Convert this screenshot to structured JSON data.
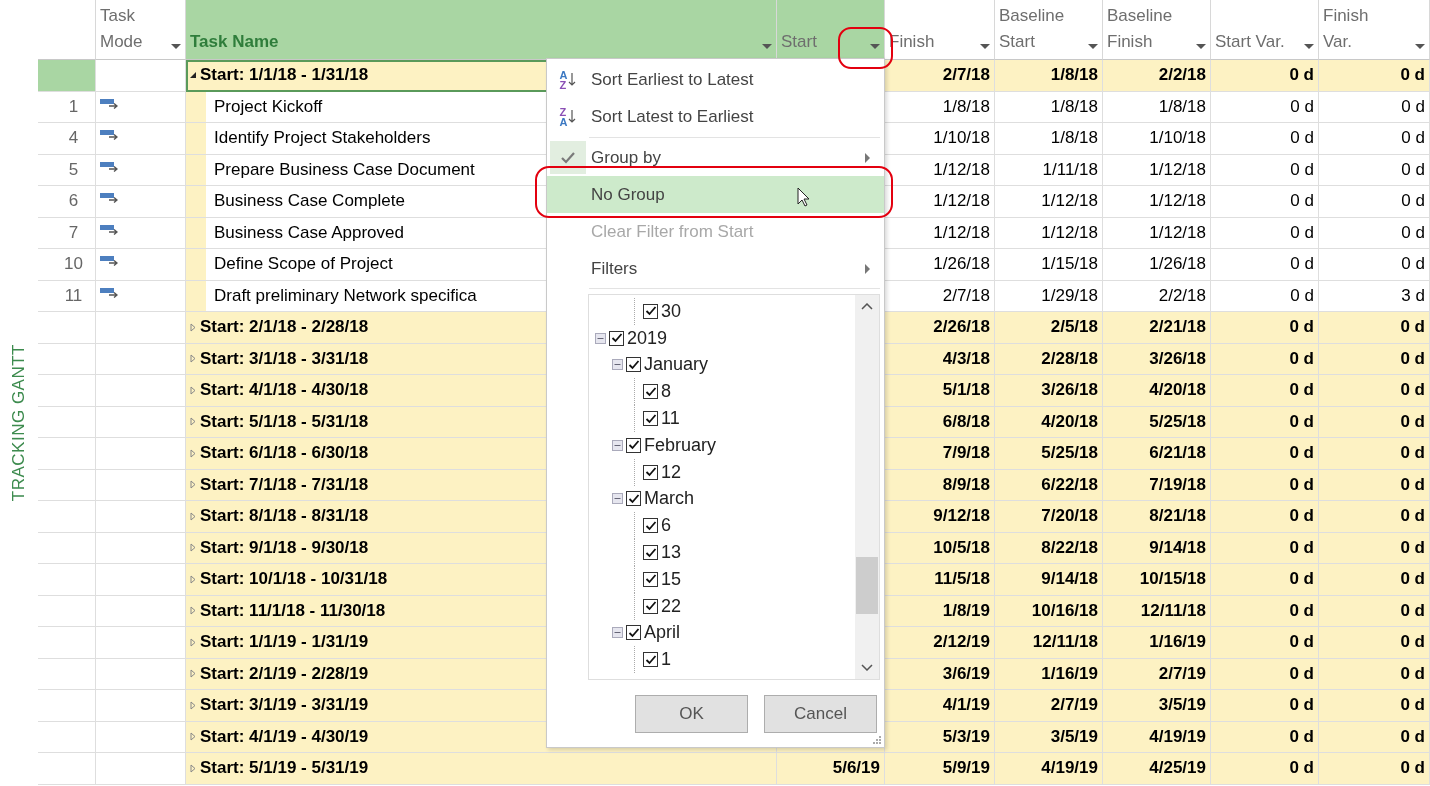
{
  "side_label": "TRACKING GANTT",
  "table": {
    "columns": [
      {
        "label": "Task\nMode",
        "selected": false,
        "hovered": false
      },
      {
        "label": "Task Name",
        "selected": true,
        "hovered": false
      },
      {
        "label": "Start",
        "selected": false,
        "hovered": true
      },
      {
        "label": "Finish",
        "selected": false,
        "hovered": false
      },
      {
        "label": "Baseline\nStart",
        "selected": false,
        "hovered": false
      },
      {
        "label": "Baseline\nFinish",
        "selected": false,
        "hovered": false
      },
      {
        "label": "Start Var.",
        "selected": false,
        "hovered": false
      },
      {
        "label": "Finish\nVar.",
        "selected": false,
        "hovered": false
      }
    ],
    "rows": [
      {
        "kind": "group",
        "expanded": true,
        "selected": true,
        "name": "Start: 1/1/18 - 1/31/18",
        "finish": "2/7/18",
        "baseline_start": "1/8/18",
        "baseline_finish": "2/2/18",
        "start_var": "0 d",
        "finish_var": "0 d"
      },
      {
        "kind": "task",
        "expanded": false,
        "selected": false,
        "id": "1",
        "name": "Project Kickoff",
        "finish": "1/8/18",
        "baseline_start": "1/8/18",
        "baseline_finish": "1/8/18",
        "start_var": "0 d",
        "finish_var": "0 d"
      },
      {
        "kind": "task",
        "expanded": false,
        "selected": false,
        "id": "4",
        "name": "Identify Project Stakeholders",
        "finish": "1/10/18",
        "baseline_start": "1/8/18",
        "baseline_finish": "1/10/18",
        "start_var": "0 d",
        "finish_var": "0 d"
      },
      {
        "kind": "task",
        "expanded": false,
        "selected": false,
        "id": "5",
        "name": "Prepare Business Case Document",
        "finish": "1/12/18",
        "baseline_start": "1/11/18",
        "baseline_finish": "1/12/18",
        "start_var": "0 d",
        "finish_var": "0 d"
      },
      {
        "kind": "task",
        "expanded": false,
        "selected": false,
        "id": "6",
        "name": "Business Case Complete",
        "finish": "1/12/18",
        "baseline_start": "1/12/18",
        "baseline_finish": "1/12/18",
        "start_var": "0 d",
        "finish_var": "0 d"
      },
      {
        "kind": "task",
        "expanded": false,
        "selected": false,
        "id": "7",
        "name": "Business Case Approved",
        "finish": "1/12/18",
        "baseline_start": "1/12/18",
        "baseline_finish": "1/12/18",
        "start_var": "0 d",
        "finish_var": "0 d"
      },
      {
        "kind": "task",
        "expanded": false,
        "selected": false,
        "id": "10",
        "name": "Define Scope of Project",
        "finish": "1/26/18",
        "baseline_start": "1/15/18",
        "baseline_finish": "1/26/18",
        "start_var": "0 d",
        "finish_var": "0 d"
      },
      {
        "kind": "task",
        "expanded": false,
        "selected": false,
        "id": "11",
        "name": "Draft preliminary Network specifica",
        "finish": "2/7/18",
        "baseline_start": "1/29/18",
        "baseline_finish": "2/2/18",
        "start_var": "0 d",
        "finish_var": "3 d"
      },
      {
        "kind": "group",
        "expanded": false,
        "selected": false,
        "name": "Start: 2/1/18 - 2/28/18",
        "finish": "2/26/18",
        "baseline_start": "2/5/18",
        "baseline_finish": "2/21/18",
        "start_var": "0 d",
        "finish_var": "0 d"
      },
      {
        "kind": "group",
        "expanded": false,
        "selected": false,
        "name": "Start: 3/1/18 - 3/31/18",
        "finish": "4/3/18",
        "baseline_start": "2/28/18",
        "baseline_finish": "3/26/18",
        "start_var": "0 d",
        "finish_var": "0 d"
      },
      {
        "kind": "group",
        "expanded": false,
        "selected": false,
        "name": "Start: 4/1/18 - 4/30/18",
        "finish": "5/1/18",
        "baseline_start": "3/26/18",
        "baseline_finish": "4/20/18",
        "start_var": "0 d",
        "finish_var": "0 d"
      },
      {
        "kind": "group",
        "expanded": false,
        "selected": false,
        "name": "Start: 5/1/18 - 5/31/18",
        "finish": "6/8/18",
        "baseline_start": "4/20/18",
        "baseline_finish": "5/25/18",
        "start_var": "0 d",
        "finish_var": "0 d"
      },
      {
        "kind": "group",
        "expanded": false,
        "selected": false,
        "name": "Start: 6/1/18 - 6/30/18",
        "finish": "7/9/18",
        "baseline_start": "5/25/18",
        "baseline_finish": "6/21/18",
        "start_var": "0 d",
        "finish_var": "0 d"
      },
      {
        "kind": "group",
        "expanded": false,
        "selected": false,
        "name": "Start: 7/1/18 - 7/31/18",
        "finish": "8/9/18",
        "baseline_start": "6/22/18",
        "baseline_finish": "7/19/18",
        "start_var": "0 d",
        "finish_var": "0 d"
      },
      {
        "kind": "group",
        "expanded": false,
        "selected": false,
        "name": "Start: 8/1/18 - 8/31/18",
        "finish": "9/12/18",
        "baseline_start": "7/20/18",
        "baseline_finish": "8/21/18",
        "start_var": "0 d",
        "finish_var": "0 d"
      },
      {
        "kind": "group",
        "expanded": false,
        "selected": false,
        "name": "Start: 9/1/18 - 9/30/18",
        "finish": "10/5/18",
        "baseline_start": "8/22/18",
        "baseline_finish": "9/14/18",
        "start_var": "0 d",
        "finish_var": "0 d"
      },
      {
        "kind": "group",
        "expanded": false,
        "selected": false,
        "name": "Start: 10/1/18 - 10/31/18",
        "finish": "11/5/18",
        "baseline_start": "9/14/18",
        "baseline_finish": "10/15/18",
        "start_var": "0 d",
        "finish_var": "0 d"
      },
      {
        "kind": "group",
        "expanded": false,
        "selected": false,
        "name": "Start: 11/1/18 - 11/30/18",
        "finish": "1/8/19",
        "baseline_start": "10/16/18",
        "baseline_finish": "12/11/18",
        "start_var": "0 d",
        "finish_var": "0 d"
      },
      {
        "kind": "group",
        "expanded": false,
        "selected": false,
        "name": "Start: 1/1/19 - 1/31/19",
        "finish": "2/12/19",
        "baseline_start": "12/11/18",
        "baseline_finish": "1/16/19",
        "start_var": "0 d",
        "finish_var": "0 d"
      },
      {
        "kind": "group",
        "expanded": false,
        "selected": false,
        "name": "Start: 2/1/19 - 2/28/19",
        "finish": "3/6/19",
        "baseline_start": "1/16/19",
        "baseline_finish": "2/7/19",
        "start_var": "0 d",
        "finish_var": "0 d"
      },
      {
        "kind": "group",
        "expanded": false,
        "selected": false,
        "name": "Start: 3/1/19 - 3/31/19",
        "finish": "4/1/19",
        "baseline_start": "2/7/19",
        "baseline_finish": "3/5/19",
        "start_var": "0 d",
        "finish_var": "0 d"
      },
      {
        "kind": "group",
        "expanded": false,
        "selected": false,
        "name": "Start: 4/1/19 - 4/30/19",
        "finish": "5/3/19",
        "baseline_start": "3/5/19",
        "baseline_finish": "4/19/19",
        "start_var": "0 d",
        "finish_var": "0 d"
      },
      {
        "kind": "group",
        "expanded": false,
        "selected": false,
        "name": "Start: 5/1/19 - 5/31/19",
        "start": "5/6/19",
        "finish": "5/9/19",
        "baseline_start": "4/19/19",
        "baseline_finish": "4/25/19",
        "start_var": "0 d",
        "finish_var": "0 d"
      }
    ]
  },
  "column_menu": {
    "items": [
      {
        "label": "Sort Earliest to Latest",
        "kind": "sort_ascending",
        "icon_letters": [
          "A",
          "Z"
        ],
        "checked": false,
        "disabled": false,
        "highlighted": false,
        "submenu": false
      },
      {
        "label": "Sort Latest to Earliest",
        "kind": "sort_descending",
        "icon_letters": [
          "Z",
          "A"
        ],
        "checked": false,
        "disabled": false,
        "highlighted": false,
        "submenu": false
      },
      {
        "kind": "separator"
      },
      {
        "label": "Group by",
        "kind": "command",
        "checked": true,
        "disabled": false,
        "highlighted": false,
        "submenu": true
      },
      {
        "label": "No Group",
        "kind": "command",
        "checked": false,
        "disabled": false,
        "highlighted": true,
        "submenu": false
      },
      {
        "label": "Clear Filter from Start",
        "kind": "command",
        "checked": false,
        "disabled": true,
        "highlighted": false,
        "submenu": false
      },
      {
        "label": "Filters",
        "kind": "command",
        "checked": false,
        "disabled": false,
        "highlighted": false,
        "submenu": true
      }
    ],
    "filter_tree": {
      "continued": [
        {
          "label": "30",
          "checked": true
        }
      ],
      "nodes": [
        {
          "label": "2019",
          "checked": true,
          "expanded": true,
          "children": [
            {
              "label": "January",
              "checked": true,
              "expanded": true,
              "children": [
                {
                  "label": "8",
                  "checked": true
                },
                {
                  "label": "11",
                  "checked": true
                }
              ]
            },
            {
              "label": "February",
              "checked": true,
              "expanded": true,
              "children": [
                {
                  "label": "12",
                  "checked": true
                }
              ]
            },
            {
              "label": "March",
              "checked": true,
              "expanded": true,
              "children": [
                {
                  "label": "6",
                  "checked": true
                },
                {
                  "label": "13",
                  "checked": true
                },
                {
                  "label": "15",
                  "checked": true
                },
                {
                  "label": "22",
                  "checked": true
                }
              ]
            },
            {
              "label": "April",
              "checked": true,
              "expanded": true,
              "children": [
                {
                  "label": "1",
                  "checked": true
                }
              ]
            }
          ]
        }
      ]
    },
    "buttons": [
      "OK",
      "Cancel"
    ]
  }
}
